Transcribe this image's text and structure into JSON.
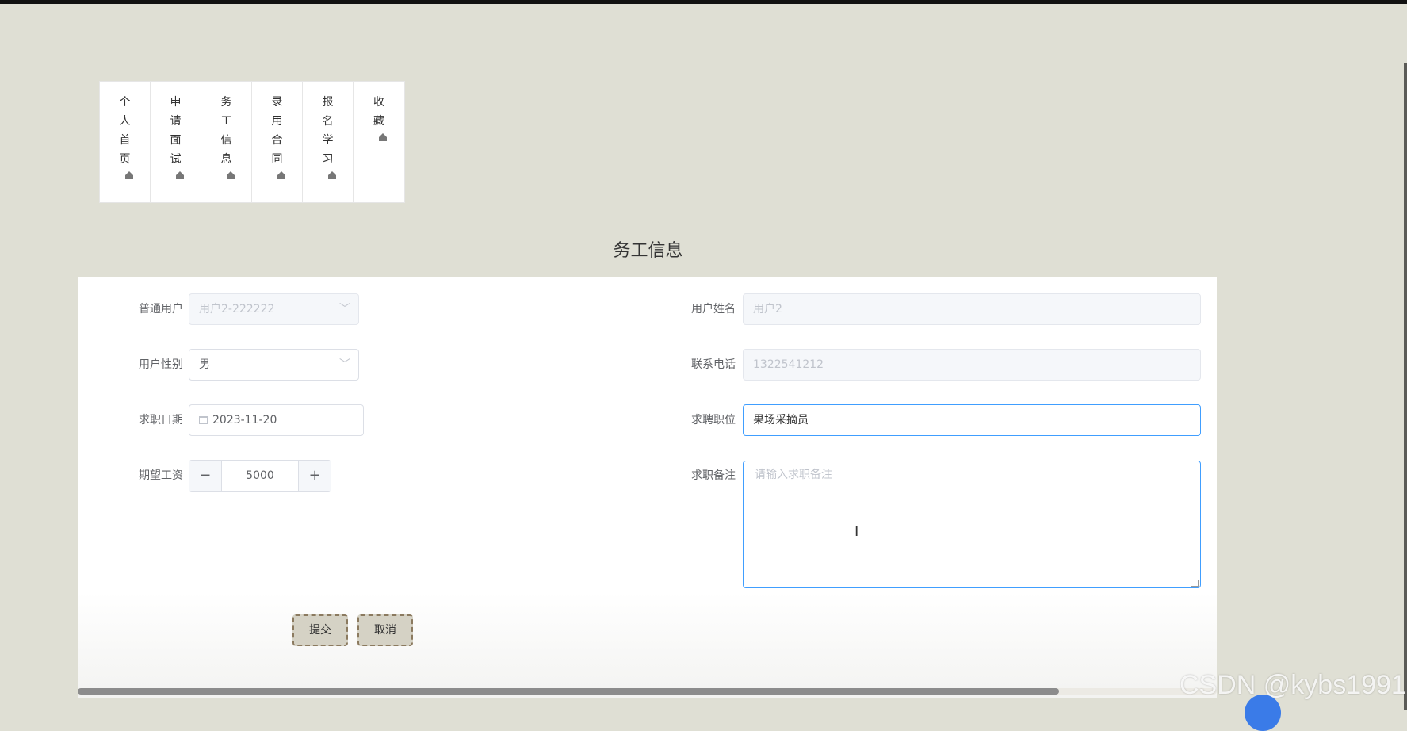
{
  "nav": {
    "items": [
      {
        "label": "个人首页",
        "icon": "home-icon"
      },
      {
        "label": "申请面试",
        "icon": "home-icon"
      },
      {
        "label": "务工信息",
        "icon": "home-icon"
      },
      {
        "label": "录用合同",
        "icon": "home-icon"
      },
      {
        "label": "报名学习",
        "icon": "home-icon"
      },
      {
        "label": "收藏",
        "icon": "home-icon"
      }
    ]
  },
  "page_title": "务工信息",
  "form": {
    "user_label": "普通用户",
    "user_value": "用户2-222222",
    "name_label": "用户姓名",
    "name_placeholder": "用户2",
    "gender_label": "用户性别",
    "gender_value": "男",
    "phone_label": "联系电话",
    "phone_placeholder": "1322541212",
    "date_label": "求职日期",
    "date_value": "2023-11-20",
    "position_label": "求聘职位",
    "position_value": "果场采摘员",
    "salary_label": "期望工资",
    "salary_value": "5000",
    "remark_label": "求职备注",
    "remark_placeholder": "请输入求职备注"
  },
  "buttons": {
    "submit": "提交",
    "cancel": "取消"
  },
  "watermark": "CSDN @kybs1991",
  "colors": {
    "background": "#dfdfd4",
    "focus_border": "#409eff",
    "button_bg": "#d5d2c5",
    "button_border": "#8b7a5f"
  }
}
